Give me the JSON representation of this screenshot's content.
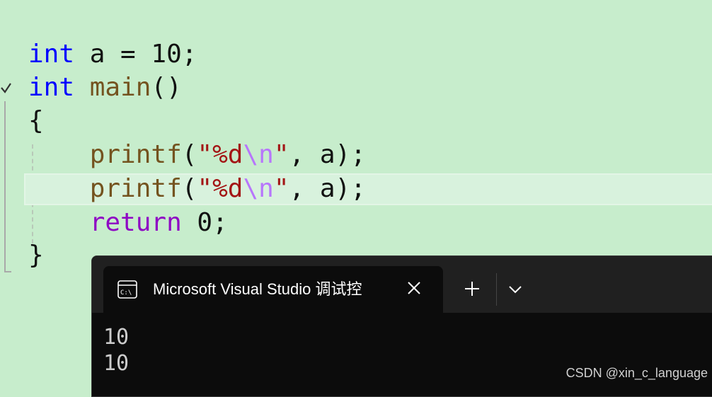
{
  "editor": {
    "lines": [
      {
        "t1": "int",
        "t2": " a = 10;"
      },
      {
        "t1": "int",
        "t2": " ",
        "t3": "main",
        "t4": "()"
      },
      {
        "t1": "{"
      },
      {
        "indent": "    ",
        "fn": "printf",
        "open": "(",
        "str1": "\"%d",
        "esc": "\\n",
        "str2": "\"",
        "rest": ", a);"
      },
      {
        "indent": "    ",
        "fn": "printf",
        "open": "(",
        "str1": "\"%d",
        "esc": "\\n",
        "str2": "\"",
        "rest": ", a);"
      },
      {
        "indent": "    ",
        "kw": "return",
        "rest": " 0;"
      },
      {
        "t1": "}"
      }
    ]
  },
  "terminal": {
    "tab_title": "Microsoft Visual Studio 调试控",
    "tab_icon": "console-icon",
    "output": [
      "10",
      "10"
    ]
  },
  "watermark": "CSDN @xin_c_language",
  "colors": {
    "editor_bg": "#c7edcc",
    "keyword": "#0000ff",
    "function": "#74531f",
    "string": "#a31515",
    "escape": "#b776fb",
    "control_keyword": "#8f08c4",
    "terminal_bg": "#0c0c0c",
    "titlebar_bg": "#202020"
  }
}
